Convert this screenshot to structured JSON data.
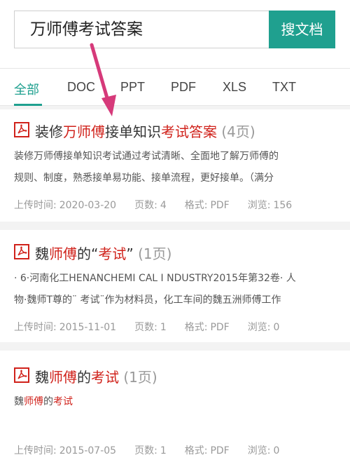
{
  "search": {
    "query": "万师傅考试答案",
    "button_label": "搜文档"
  },
  "tabs": [
    {
      "label": "全部",
      "active": true
    },
    {
      "label": "DOC"
    },
    {
      "label": "PPT"
    },
    {
      "label": "PDF"
    },
    {
      "label": "XLS"
    },
    {
      "label": "TXT"
    }
  ],
  "results": [
    {
      "title_parts": [
        {
          "text": "装修",
          "hl": false
        },
        {
          "text": "万师傅",
          "hl": true
        },
        {
          "text": "接单知识",
          "hl": false
        },
        {
          "text": "考试答案",
          "hl": true
        }
      ],
      "pages_label": "(4页)",
      "snippet_lines": [
        "装修万师傅接单知识考试通过考试清晰、全面地了解万师傅的",
        "规则、制度，熟悉接单易功能、接单流程，更好接单。（满分"
      ],
      "upload_label": "上传时间:",
      "upload_date": "2020-03-20",
      "pages_count_label": "页数:",
      "pages_count": "4",
      "format_label": "格式:",
      "format": "PDF",
      "views_label": "浏览:",
      "views": "156"
    },
    {
      "title_parts": [
        {
          "text": "魏",
          "hl": false
        },
        {
          "text": "师傅",
          "hl": true
        },
        {
          "text": "的“",
          "hl": false
        },
        {
          "text": "考试",
          "hl": true
        },
        {
          "text": "”",
          "hl": false
        }
      ],
      "pages_label": "(1页)",
      "snippet_lines": [
        "· 6·河南化工HENANCHEMI CAL I NDUSTRY2015年第32卷· 人",
        "物·魏师T尊的¨ 考试¨作为材料员，化工车间的魏五洲师傅工作"
      ],
      "upload_label": "上传时间:",
      "upload_date": "2015-11-01",
      "pages_count_label": "页数:",
      "pages_count": "1",
      "format_label": "格式:",
      "format": "PDF",
      "views_label": "浏览:",
      "views": "0"
    },
    {
      "title_parts": [
        {
          "text": "魏",
          "hl": false
        },
        {
          "text": "师傅",
          "hl": true
        },
        {
          "text": "的",
          "hl": false
        },
        {
          "text": "考试",
          "hl": true
        }
      ],
      "pages_label": "(1页)",
      "snippet_parts": [
        {
          "text": "魏",
          "hl": false
        },
        {
          "text": "师傅",
          "hl": true
        },
        {
          "text": "的",
          "hl": false
        },
        {
          "text": "考试",
          "hl": true
        }
      ],
      "upload_label": "上传时间:",
      "upload_date": "2015-07-05",
      "pages_count_label": "页数:",
      "pages_count": "1",
      "format_label": "格式:",
      "format": "PDF",
      "views_label": "浏览:",
      "views": "0"
    }
  ],
  "colors": {
    "accent": "#1fa08f",
    "highlight": "#d0221b",
    "annotation_arrow": "#d63a7a"
  }
}
